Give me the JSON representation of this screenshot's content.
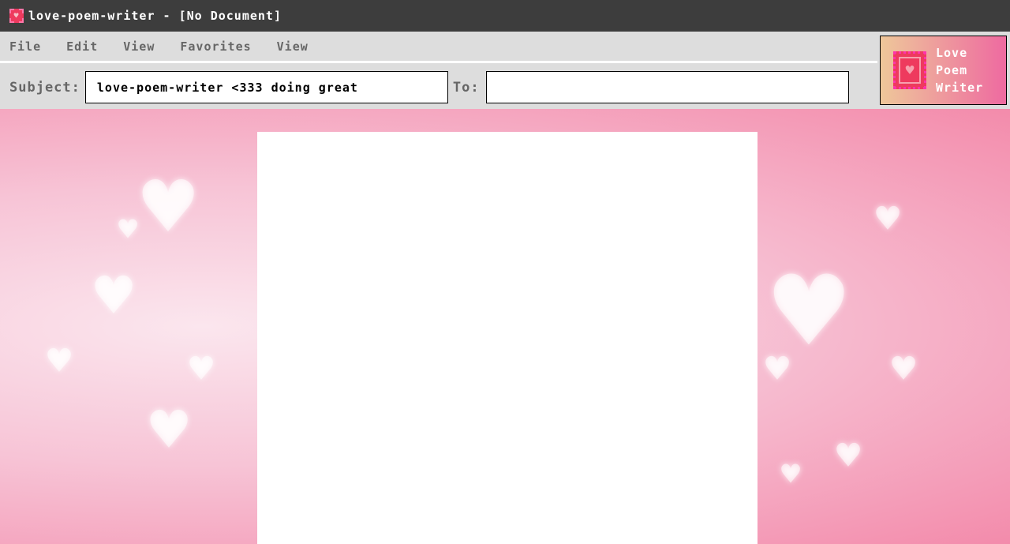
{
  "window": {
    "title": "love-poem-writer - [No Document]"
  },
  "menu": [
    "File",
    "Edit",
    "View",
    "Favorites",
    "View"
  ],
  "fields": {
    "subject_label": "Subject:",
    "subject_value": "love-poem-writer <333 doing great",
    "to_label": "To:",
    "to_value": ""
  },
  "logo": {
    "line1": "Love",
    "line2": "Poem",
    "line3": "Writer"
  },
  "colors": {
    "titlebar": "#3d3d3d",
    "accent": "#ee3a5e"
  }
}
